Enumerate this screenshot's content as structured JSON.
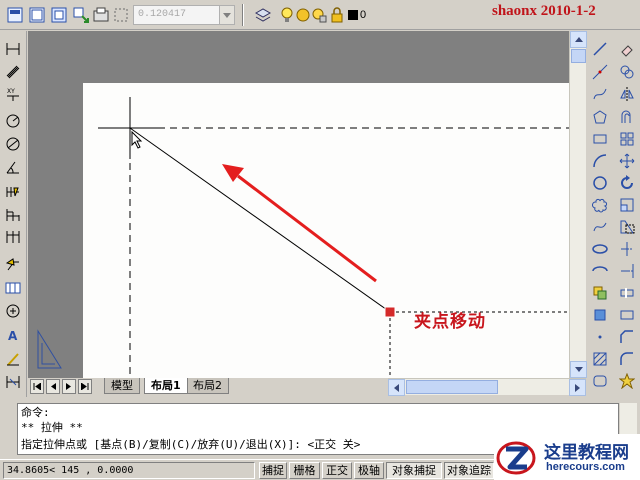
{
  "toolbar": {
    "lineweight_value": "0.120417",
    "layer_value": "0",
    "watermark": "shaonx 2010-1-2"
  },
  "drawing": {
    "annotation": "夹点移动",
    "colors": {
      "annotation": "#c8161d",
      "grip": "#d42a2a",
      "paper": "#fdfdfc",
      "background": "#808080"
    }
  },
  "tabs": {
    "items": [
      {
        "label": "模型"
      },
      {
        "label": "布局1"
      },
      {
        "label": "布局2"
      }
    ],
    "active": "布局1"
  },
  "command": {
    "line1": "命令:",
    "line2": "** 拉伸 **",
    "line3": "指定拉伸点或 [基点(B)/复制(C)/放弃(U)/退出(X)]:  <正交 关>"
  },
  "status": {
    "coordinates": "34.8605< 145      , 0.0000",
    "buttons": [
      {
        "label": "捕捉"
      },
      {
        "label": "栅格"
      },
      {
        "label": "正交"
      },
      {
        "label": "极轴"
      },
      {
        "label": "对象捕捉"
      },
      {
        "label": "对象追踪"
      }
    ]
  },
  "logo": {
    "title": "这里教程网",
    "url": "herecours.com"
  },
  "icons": {
    "top": [
      "new-icon",
      "open-icon",
      "save-icon",
      "plot-icon",
      "preview-icon",
      "layer-manager-icon",
      "layer-state-icon"
    ],
    "left": [
      "linear-dimension-icon",
      "aligned-dimension-icon",
      "ordinate-dimension-icon",
      "radius-dimension-icon",
      "diameter-dimension-icon",
      "angular-dimension-icon",
      "quick-dimension-icon",
      "baseline-dimension-icon",
      "continue-dimension-icon",
      "leader-icon",
      "tolerance-icon",
      "center-mark-icon",
      "dimension-edit-icon",
      "dimension-text-edit-icon",
      "dimension-update-icon"
    ],
    "draw": [
      "line-icon",
      "construction-line-icon",
      "polyline-icon",
      "polygon-icon",
      "rectangle-icon",
      "arc-icon",
      "circle-icon",
      "revision-cloud-icon",
      "spline-icon",
      "ellipse-icon",
      "ellipse-arc-icon",
      "insert-block-icon",
      "make-block-icon",
      "point-icon",
      "hatch-icon",
      "region-icon"
    ],
    "modify": [
      "erase-icon",
      "copy-icon",
      "mirror-icon",
      "offset-icon",
      "array-icon",
      "move-icon",
      "rotate-icon",
      "scale-icon",
      "stretch-icon",
      "trim-icon",
      "extend-icon",
      "break-icon",
      "join-icon",
      "chamfer-icon",
      "fillet-icon",
      "explode-icon"
    ]
  }
}
